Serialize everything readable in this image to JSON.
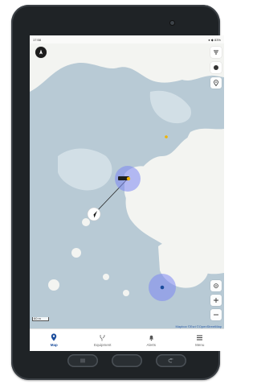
{
  "statusbar": {
    "time": "17:58",
    "right": "● ◆ 83%"
  },
  "map": {
    "colors": {
      "land": "#f3f4f1",
      "water": "#b9cbd6",
      "shallow": "#d3dfe6",
      "halo": "#7b86f2",
      "route": "#222222"
    }
  },
  "scale": {
    "label": "60 m"
  },
  "attribution": "Mapbox  ©Esri  ©OpenStreetMap",
  "nav": {
    "items": [
      {
        "label": "Map",
        "icon": "map-pin-icon"
      },
      {
        "label": "Equipment",
        "icon": "tool-icon"
      },
      {
        "label": "Alerts",
        "icon": "bell-icon"
      },
      {
        "label": "Menu",
        "icon": "menu-icon"
      }
    ]
  }
}
